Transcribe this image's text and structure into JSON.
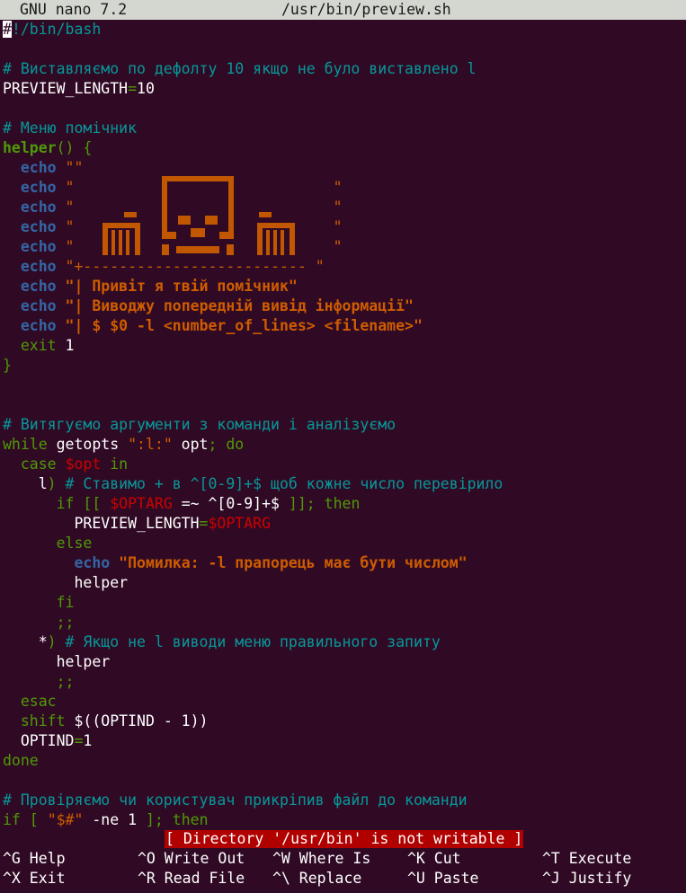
{
  "titlebar": {
    "app": "GNU nano 7.2",
    "file": "/usr/bin/preview.sh"
  },
  "code": [
    [
      {
        "t": "#",
        "c": "cur"
      },
      {
        "t": "!/bin/bash",
        "c": "cm"
      }
    ],
    [],
    [
      {
        "t": "# Виставляємо по дефолту 10 якщо не було виставлено l",
        "c": "cm"
      }
    ],
    [
      {
        "t": "PREVIEW_LENGTH"
      },
      {
        "t": "=",
        "c": "kw"
      },
      {
        "t": "10"
      }
    ],
    [],
    [
      {
        "t": "# Меню помічник",
        "c": "cm"
      }
    ],
    [
      {
        "t": "helper",
        "c": "fn"
      },
      {
        "t": "() {",
        "c": "kw"
      }
    ],
    [
      {
        "t": "  "
      },
      {
        "t": "echo",
        "c": "bi"
      },
      {
        "t": " \"\"",
        "c": "strn"
      }
    ],
    [
      {
        "t": "  "
      },
      {
        "t": "echo",
        "c": "bi"
      },
      {
        "t": " \"                             \"",
        "c": "strn"
      }
    ],
    [
      {
        "t": "  "
      },
      {
        "t": "echo",
        "c": "bi"
      },
      {
        "t": " \"                             \"",
        "c": "strn"
      }
    ],
    [
      {
        "t": "  "
      },
      {
        "t": "echo",
        "c": "bi"
      },
      {
        "t": " \"                             \"",
        "c": "strn"
      }
    ],
    [
      {
        "t": "  "
      },
      {
        "t": "echo",
        "c": "bi"
      },
      {
        "t": " \"                             \"",
        "c": "strn"
      }
    ],
    [
      {
        "t": "  "
      },
      {
        "t": "echo",
        "c": "bi"
      },
      {
        "t": " \"+------------------------- \"",
        "c": "strn"
      }
    ],
    [
      {
        "t": "  "
      },
      {
        "t": "echo",
        "c": "bi"
      },
      {
        "t": " \"| Привіт я твій помічник\"",
        "c": "str"
      }
    ],
    [
      {
        "t": "  "
      },
      {
        "t": "echo",
        "c": "bi"
      },
      {
        "t": " \"| Виводжу попередній вивід інформації\"",
        "c": "str"
      }
    ],
    [
      {
        "t": "  "
      },
      {
        "t": "echo",
        "c": "bi"
      },
      {
        "t": " \"| $ $0 -l <number_of_lines> <filename>\"",
        "c": "str"
      }
    ],
    [
      {
        "t": "  "
      },
      {
        "t": "exit",
        "c": "kw"
      },
      {
        "t": " 1"
      }
    ],
    [
      {
        "t": "}",
        "c": "kw"
      }
    ],
    [],
    [],
    [
      {
        "t": "# Витягуємо аргументи з команди і аналізуємо",
        "c": "cm"
      }
    ],
    [
      {
        "t": "while",
        "c": "kw"
      },
      {
        "t": " getopts "
      },
      {
        "t": "\":l:\"",
        "c": "strn"
      },
      {
        "t": " opt"
      },
      {
        "t": "; do",
        "c": "kw"
      }
    ],
    [
      {
        "t": "  "
      },
      {
        "t": "case",
        "c": "kw"
      },
      {
        "t": " "
      },
      {
        "t": "$opt",
        "c": "var"
      },
      {
        "t": " "
      },
      {
        "t": "in",
        "c": "kw"
      }
    ],
    [
      {
        "t": "    l"
      },
      {
        "t": ")",
        "c": "kw"
      },
      {
        "t": " "
      },
      {
        "t": "# Ставимо + в ^[0-9]+$ щоб кожне число перевірило",
        "c": "cm"
      }
    ],
    [
      {
        "t": "      "
      },
      {
        "t": "if [[",
        "c": "kw"
      },
      {
        "t": " "
      },
      {
        "t": "$OPTARG",
        "c": "var"
      },
      {
        "t": " =~ ^[0-9]+$ "
      },
      {
        "t": "]]; then",
        "c": "kw"
      }
    ],
    [
      {
        "t": "        PREVIEW_LENGTH"
      },
      {
        "t": "=",
        "c": "kw"
      },
      {
        "t": "$OPTARG",
        "c": "var"
      }
    ],
    [
      {
        "t": "      "
      },
      {
        "t": "else",
        "c": "kw"
      }
    ],
    [
      {
        "t": "        "
      },
      {
        "t": "echo",
        "c": "bi"
      },
      {
        "t": " \"Помилка: -l прапорець має бути числом\"",
        "c": "str"
      }
    ],
    [
      {
        "t": "        helper"
      }
    ],
    [
      {
        "t": "      "
      },
      {
        "t": "fi",
        "c": "kw"
      }
    ],
    [
      {
        "t": "      "
      },
      {
        "t": ";;",
        "c": "kw"
      }
    ],
    [
      {
        "t": "    *"
      },
      {
        "t": ")",
        "c": "kw"
      },
      {
        "t": " "
      },
      {
        "t": "# Якщо не l виводи меню правильного запиту",
        "c": "cm"
      }
    ],
    [
      {
        "t": "      helper"
      }
    ],
    [
      {
        "t": "      "
      },
      {
        "t": ";;",
        "c": "kw"
      }
    ],
    [
      {
        "t": "  "
      },
      {
        "t": "esac",
        "c": "kw"
      }
    ],
    [
      {
        "t": "  "
      },
      {
        "t": "shift",
        "c": "kw"
      },
      {
        "t": " $((OPTIND - 1))"
      }
    ],
    [
      {
        "t": "  OPTIND"
      },
      {
        "t": "=",
        "c": "kw"
      },
      {
        "t": "1"
      }
    ],
    [
      {
        "t": "done",
        "c": "kw"
      }
    ],
    [],
    [
      {
        "t": "# Провіряємо чи користувач прикріпив файл до команди",
        "c": "cm"
      }
    ],
    [
      {
        "t": "if [",
        "c": "kw"
      },
      {
        "t": " "
      },
      {
        "t": "\"$#\"",
        "c": "strn"
      },
      {
        "t": " -ne 1 "
      },
      {
        "t": "]; then",
        "c": "kw"
      }
    ]
  ],
  "art_color": "#c15700",
  "status_message": "[ Directory '/usr/bin' is not writable ]",
  "shortcuts": [
    [
      {
        "key": "^G",
        "label": "Help"
      },
      {
        "key": "^O",
        "label": "Write Out"
      },
      {
        "key": "^W",
        "label": "Where Is"
      },
      {
        "key": "^K",
        "label": "Cut"
      },
      {
        "key": "^T",
        "label": "Execute"
      }
    ],
    [
      {
        "key": "^X",
        "label": "Exit"
      },
      {
        "key": "^R",
        "label": "Read File"
      },
      {
        "key": "^\\",
        "label": "Replace"
      },
      {
        "key": "^U",
        "label": "Paste"
      },
      {
        "key": "^J",
        "label": "Justify"
      }
    ]
  ]
}
